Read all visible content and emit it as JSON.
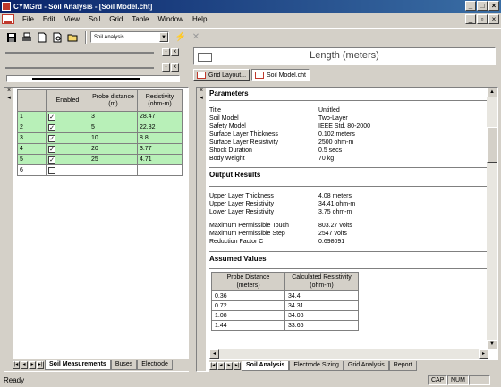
{
  "window": {
    "title": "CYMGrd - Soil Analysis - [Soil Model.cht]"
  },
  "menu": [
    "File",
    "Edit",
    "View",
    "Soil",
    "Grid",
    "Table",
    "Window",
    "Help"
  ],
  "toolbar": {
    "combo_value": "Soil Analysis"
  },
  "upper_right": {
    "axis_label": "Length (meters)",
    "tabs": [
      "Grid Layout...",
      "Soil Model.cht"
    ]
  },
  "grid": {
    "headers": {
      "enabled": "Enabled",
      "probe": "Probe distance (m)",
      "resistivity": "Resistivity (ohm-m)"
    },
    "rows": [
      {
        "num": "1",
        "checked": true,
        "probe": "3",
        "resistivity": "28.47"
      },
      {
        "num": "2",
        "checked": true,
        "probe": "5",
        "resistivity": "22.82"
      },
      {
        "num": "3",
        "checked": true,
        "probe": "10",
        "resistivity": "8.8"
      },
      {
        "num": "4",
        "checked": true,
        "probe": "20",
        "resistivity": "3.77"
      },
      {
        "num": "5",
        "checked": true,
        "probe": "25",
        "resistivity": "4.71"
      },
      {
        "num": "6",
        "checked": false,
        "probe": "",
        "resistivity": ""
      }
    ],
    "tabs": [
      "Soil Measurements",
      "Buses",
      "Electrode"
    ]
  },
  "report": {
    "parameters_title": "Parameters",
    "parameters": [
      {
        "k": "Title",
        "v": "Untitled"
      },
      {
        "k": "Soil Model",
        "v": "Two-Layer"
      },
      {
        "k": "Safety Model",
        "v": "IEEE Std. 80-2000"
      },
      {
        "k": "Surface Layer Thickness",
        "v": "0.102 meters"
      },
      {
        "k": "Surface Layer Resistivity",
        "v": "2500 ohm-m"
      },
      {
        "k": "Shock Duration",
        "v": "0.5 secs"
      },
      {
        "k": "Body Weight",
        "v": "70 kg"
      }
    ],
    "output_title": "Output Results",
    "output_layers": [
      {
        "k": "Upper Layer Thickness",
        "v": "4.08 meters"
      },
      {
        "k": "Upper Layer Resistivity",
        "v": "34.41 ohm-m"
      },
      {
        "k": "Lower Layer Resistivity",
        "v": "3.75 ohm-m"
      }
    ],
    "output_limits": [
      {
        "k": "Maximum Permissible Touch",
        "v": "803.27 volts"
      },
      {
        "k": "Maximum Permissible Step",
        "v": "2547 volts"
      },
      {
        "k": "Reduction Factor C",
        "v": "0.698091"
      }
    ],
    "assumed_title": "Assumed Values",
    "assumed_headers": [
      "Probe Distance (meters)",
      "Calculated Resistivity (ohm-m)"
    ],
    "assumed_rows": [
      [
        "0.36",
        "34.4"
      ],
      [
        "0.72",
        "34.31"
      ],
      [
        "1.08",
        "34.08"
      ],
      [
        "1.44",
        "33.66"
      ]
    ],
    "tabs": [
      "Soil Analysis",
      "Electrode Sizing",
      "Grid Analysis",
      "Report"
    ]
  },
  "status": {
    "text": "Ready",
    "cap": "CAP",
    "num": "NUM"
  }
}
